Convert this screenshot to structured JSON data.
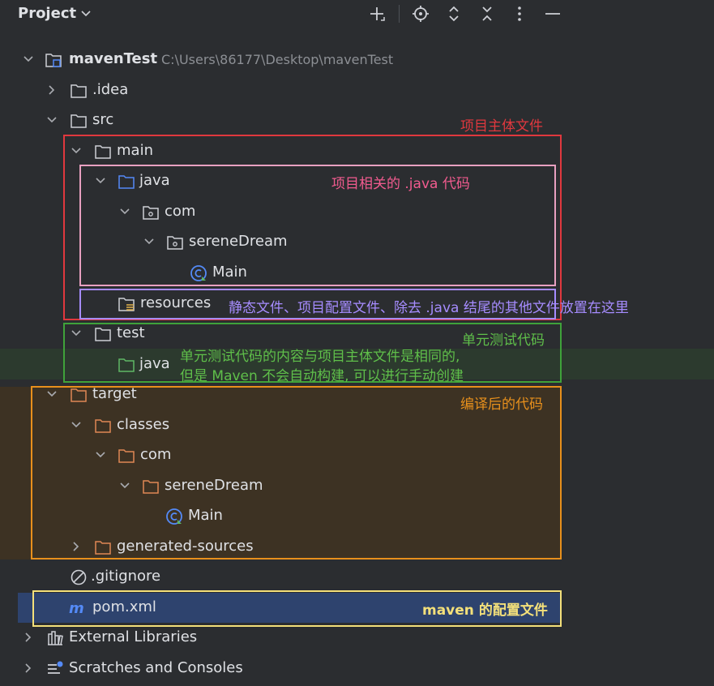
{
  "header": {
    "title": "Project",
    "chevron_icon": "chevron-down-icon",
    "toolbar_icons": [
      "add-icon",
      "locate-icon",
      "expand-collapse-icon",
      "collapse-all-icon",
      "more-options-icon",
      "minimize-icon"
    ]
  },
  "tree": [
    {
      "label": "mavenTest",
      "path": "C:\\Users\\86177\\Desktop\\mavenTest",
      "icon": "project-folder-icon",
      "expanded": true
    },
    {
      "label": ".idea",
      "icon": "folder-icon",
      "expanded": false
    },
    {
      "label": "src",
      "icon": "folder-icon",
      "expanded": true
    },
    {
      "label": "main",
      "icon": "folder-icon",
      "expanded": true
    },
    {
      "label": "java",
      "icon": "source-folder-icon",
      "expanded": true
    },
    {
      "label": "com",
      "icon": "package-icon",
      "expanded": true
    },
    {
      "label": "sereneDream",
      "icon": "package-icon",
      "expanded": true
    },
    {
      "label": "Main",
      "icon": "java-class-icon"
    },
    {
      "label": "resources",
      "icon": "resources-folder-icon"
    },
    {
      "label": "test",
      "icon": "folder-icon",
      "expanded": true
    },
    {
      "label": "java",
      "icon": "test-source-folder-icon"
    },
    {
      "label": "target",
      "icon": "excluded-folder-icon",
      "expanded": true
    },
    {
      "label": "classes",
      "icon": "excluded-folder-icon",
      "expanded": true
    },
    {
      "label": "com",
      "icon": "excluded-folder-icon",
      "expanded": true
    },
    {
      "label": "sereneDream",
      "icon": "excluded-folder-icon",
      "expanded": true
    },
    {
      "label": "Main",
      "icon": "java-class-icon"
    },
    {
      "label": "generated-sources",
      "icon": "excluded-folder-icon",
      "expanded": false
    },
    {
      "label": ".gitignore",
      "icon": "ignore-file-icon"
    },
    {
      "label": "pom.xml",
      "icon": "maven-icon",
      "selected": true
    },
    {
      "label": "External Libraries",
      "icon": "libraries-icon",
      "expanded": false
    },
    {
      "label": "Scratches and Consoles",
      "icon": "scratches-icon",
      "expanded": false
    }
  ],
  "annotations": {
    "main_body": "项目主体文件",
    "java_code": "项目相关的 .java 代码",
    "resources": "静态文件、项目配置文件、除去 .java 结尾的其他文件放置在这里",
    "unit_test": "单元测试代码",
    "unit_test_line1": "单元测试代码的内容与项目主体文件是相同的,",
    "unit_test_line2": "但是 Maven 不会自动构建, 可以进行手动创建",
    "compiled": "编译后的代码",
    "maven_config": "maven 的配置文件"
  },
  "colors": {
    "background": "#2b2d30",
    "selection": "#2e436e",
    "red_annotation": "#e0383e",
    "pink_annotation": "#e8a0c0",
    "purple_annotation": "#a68cff",
    "green_annotation": "#3fa23a",
    "orange_annotation": "#e8901c",
    "yellow_annotation": "#f4e07a",
    "source_folder": "#548af7",
    "java_class": "#548af7",
    "test_folder": "#5fb865",
    "excluded_folder": "#e08855"
  }
}
